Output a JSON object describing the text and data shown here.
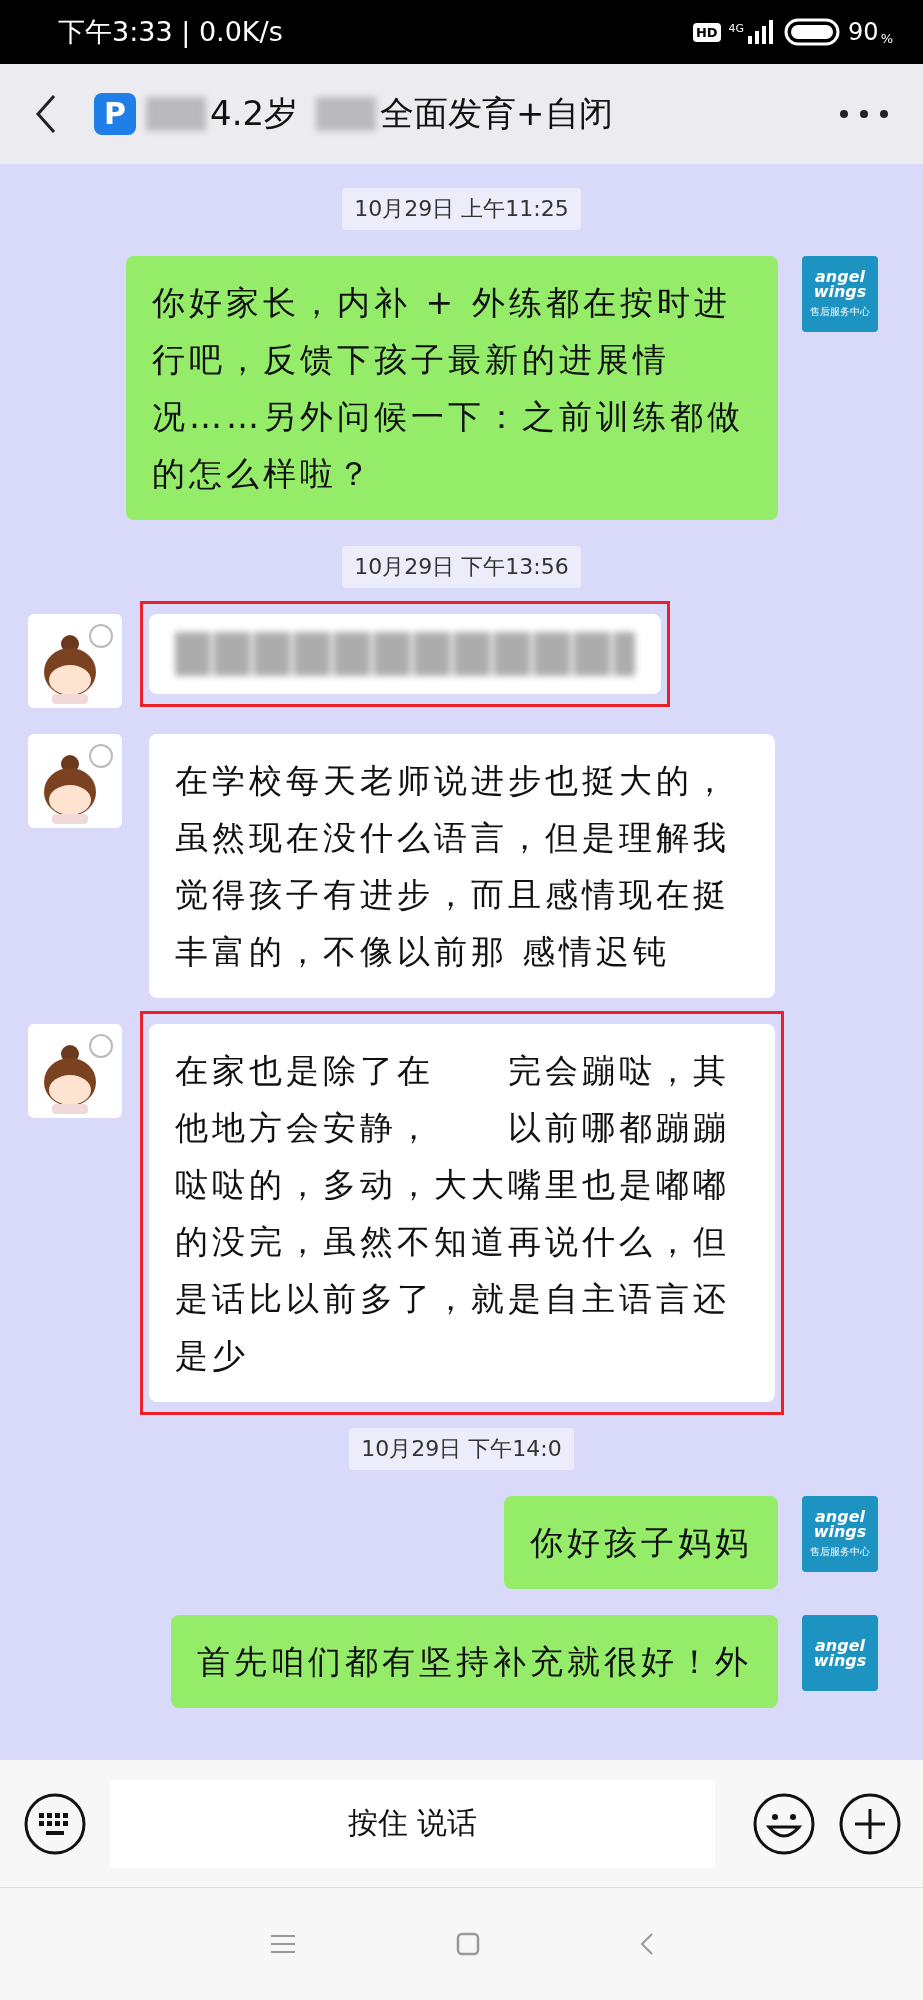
{
  "status_bar": {
    "time_speed": "下午3:33 | 0.0K/s",
    "hd": "HD",
    "network": "4G",
    "battery": "90",
    "percent_sign": "%"
  },
  "header": {
    "badge": "P",
    "title_segments": [
      {
        "kind": "blurred"
      },
      {
        "kind": "text",
        "text": "4.2岁"
      },
      {
        "kind": "blurred"
      },
      {
        "kind": "text",
        "text": "全面发育+自闭"
      }
    ]
  },
  "messages": [
    {
      "kind": "timestamp",
      "text": "10月29日 上午11:25"
    },
    {
      "kind": "sent",
      "text": "你好家长，内补 + 外练都在按时进行吧，反馈下孩子最新的进展情况……另外问候一下：之前训练都做的怎么样啦？",
      "avatar": {
        "line1": "angel",
        "line2": "wings",
        "caption": "售后服务中心"
      }
    },
    {
      "kind": "timestamp",
      "text": "10月29日 下午13:56"
    },
    {
      "kind": "received",
      "highlighted": true,
      "blurred": true
    },
    {
      "kind": "received",
      "highlighted": false,
      "blurred": false,
      "text": "在学校每天老师说进步也挺大的，虽然现在没什么语言，但是理解我觉得孩子有进步，而且感情现在挺丰富的，不像以前那 感情迟钝"
    },
    {
      "kind": "received",
      "highlighted": true,
      "blurred": false,
      "text": "在家也是除了在　　完会蹦哒，其他地方会安静，　　以前哪都蹦蹦哒哒的，多动，大大嘴里也是嘟嘟的没完，虽然不知道再说什么，但是话比以前多了，就是自主语言还是少"
    },
    {
      "kind": "timestamp",
      "text": "10月29日 下午14:0"
    },
    {
      "kind": "sent",
      "text": "你好孩子妈妈",
      "avatar": {
        "line1": "angel",
        "line2": "wings",
        "caption": "售后服务中心"
      }
    },
    {
      "kind": "sent",
      "text": "首先咱们都有坚持补充就很好！外",
      "avatar": {
        "line1": "angel",
        "line2": "wings"
      }
    }
  ],
  "input_bar": {
    "hold_to_talk": "按住 说话"
  }
}
